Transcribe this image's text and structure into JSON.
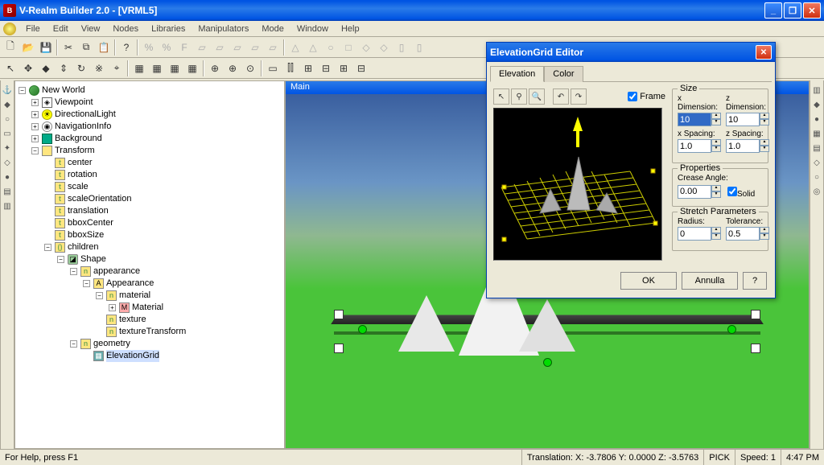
{
  "app": {
    "title": "V-Realm Builder 2.0 - [VRML5]"
  },
  "menu": [
    "File",
    "Edit",
    "View",
    "Nodes",
    "Libraries",
    "Manipulators",
    "Mode",
    "Window",
    "Help"
  ],
  "viewport": {
    "title": "Main"
  },
  "tree": {
    "root": "New World",
    "viewpoint": "Viewpoint",
    "directionallight": "DirectionalLight",
    "navigationinfo": "NavigationInfo",
    "background": "Background",
    "transform": "Transform",
    "center": "center",
    "rotation": "rotation",
    "scale": "scale",
    "scaleorientation": "scaleOrientation",
    "translation": "translation",
    "bboxcenter": "bboxCenter",
    "bboxsize": "bboxSize",
    "children": "children",
    "shape": "Shape",
    "appearance_field": "appearance",
    "appearance_node": "Appearance",
    "material_field": "material",
    "material_node": "Material",
    "texture": "texture",
    "texturetransform": "textureTransform",
    "geometry": "geometry",
    "elevationgrid": "ElevationGrid"
  },
  "dialog": {
    "title": "ElevationGrid Editor",
    "tabs": {
      "elevation": "Elevation",
      "color": "Color"
    },
    "frame_label": "Frame",
    "frame_checked": true,
    "size": {
      "group": "Size",
      "xdim_label": "x Dimension:",
      "xdim": "10",
      "zdim_label": "z Dimension:",
      "zdim": "10",
      "xspacing_label": "x Spacing:",
      "xspacing": "1.0",
      "zspacing_label": "z Spacing:",
      "zspacing": "1.0"
    },
    "props": {
      "group": "Properties",
      "crease_label": "Crease Angle:",
      "crease": "0.00",
      "solid_label": "Solid",
      "solid_checked": true
    },
    "stretch": {
      "group": "Stretch Parameters",
      "radius_label": "Radius:",
      "radius": "0",
      "tolerance_label": "Tolerance:",
      "tolerance": "0.5"
    },
    "buttons": {
      "ok": "OK",
      "cancel": "Annulla",
      "help": "?"
    }
  },
  "status": {
    "help": "For Help, press F1",
    "translation": "Translation: X: -3.7806  Y: 0.0000  Z: -3.5763",
    "pick": "PICK",
    "speed": "Speed: 1",
    "time": "4:47 PM"
  }
}
